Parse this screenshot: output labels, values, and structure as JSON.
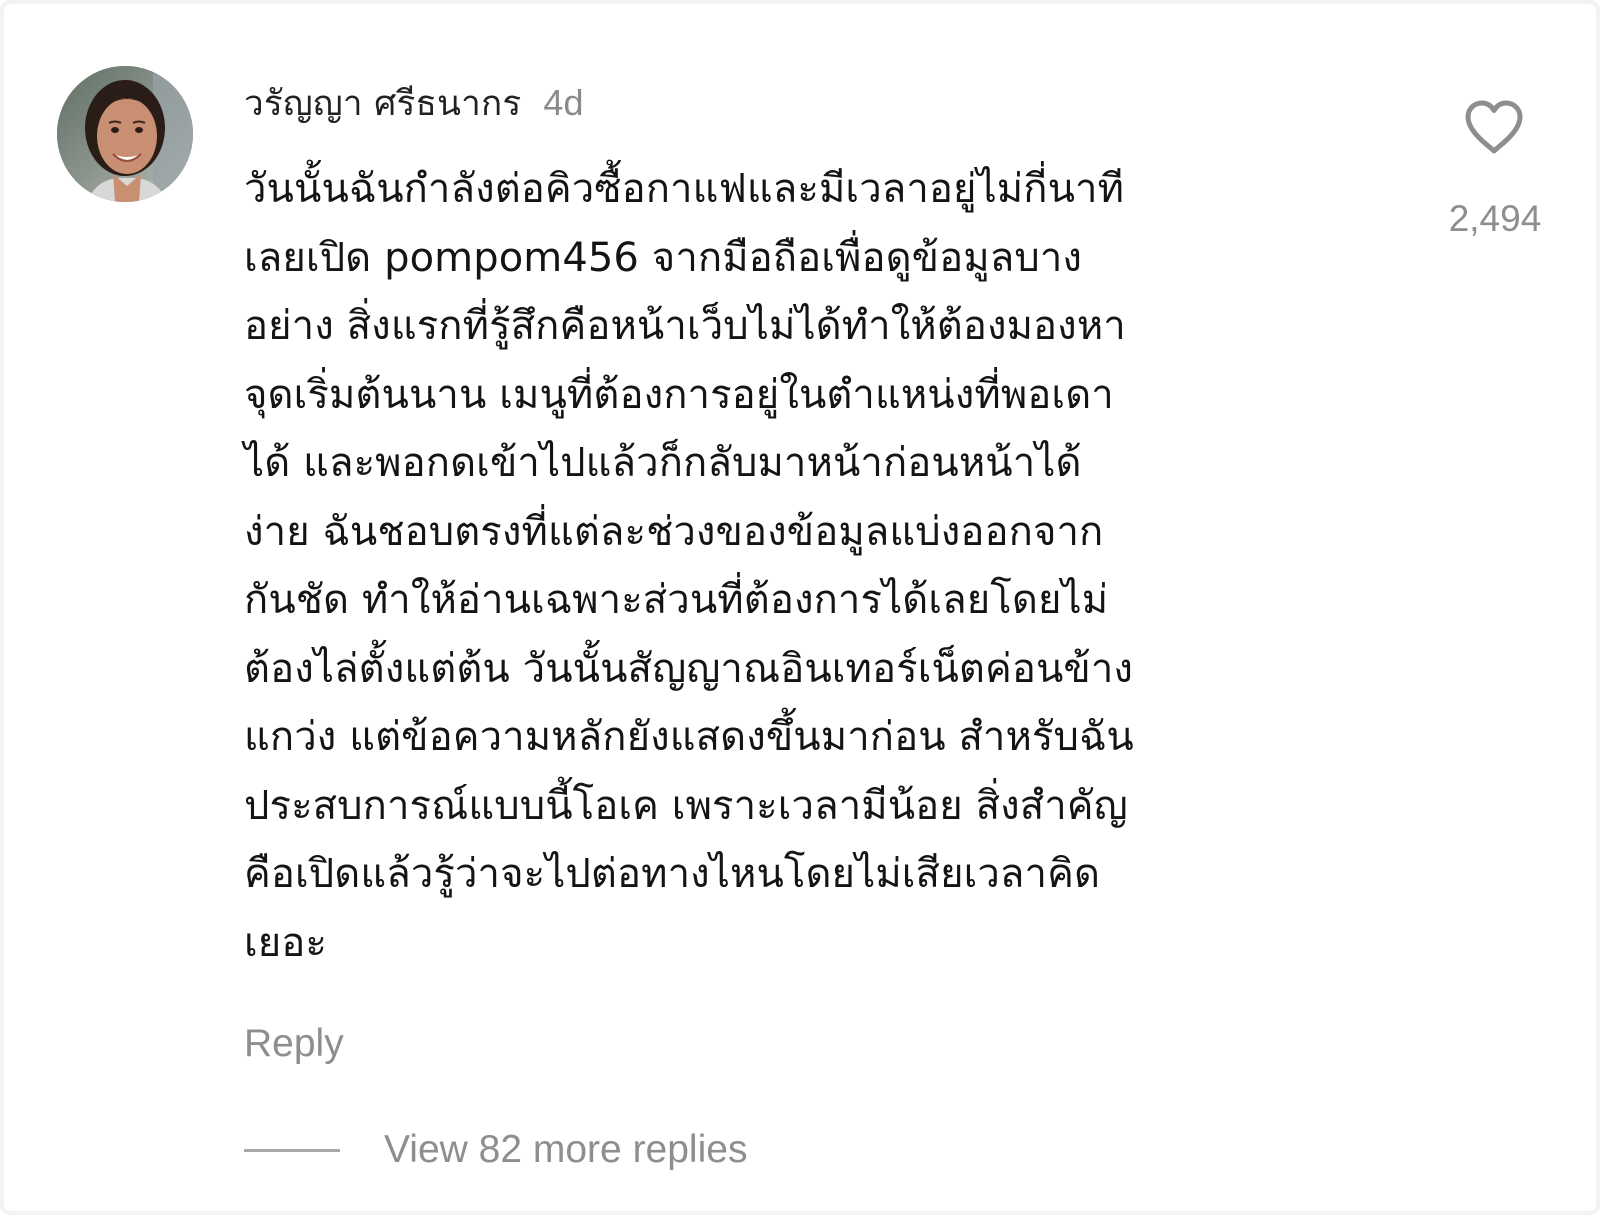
{
  "comment": {
    "username": "วรัญญา ศรีธนากร",
    "timestamp": "4d",
    "avatar_icon": "user-avatar-photo",
    "text": "วันนั้นฉันกำลังต่อคิวซื้อกาแฟและมีเวลาอยู่ไม่กี่นาที\nเลยเปิด pompom456 จากมือถือเพื่อดูข้อมูลบาง\nอย่าง สิ่งแรกที่รู้สึกคือหน้าเว็บไม่ได้ทำให้ต้องมองหา\nจุดเริ่มต้นนาน เมนูที่ต้องการอยู่ในตำแหน่งที่พอเดา\nได้ และพอกดเข้าไปแล้วก็กลับมาหน้าก่อนหน้าได้\nง่าย ฉันชอบตรงที่แต่ละช่วงของข้อมูลแบ่งออกจาก\nกันชัด ทำให้อ่านเฉพาะส่วนที่ต้องการได้เลยโดยไม่\nต้องไล่ตั้งแต่ต้น วันนั้นสัญญาณอินเทอร์เน็ตค่อนข้าง\nแกว่ง แต่ข้อความหลักยังแสดงขึ้นมาก่อน สำหรับฉัน\nประสบการณ์แบบนี้โอเค เพราะเวลามีน้อย สิ่งสำคัญ\nคือเปิดแล้วรู้ว่าจะไปต่อทางไหนโดยไม่เสียเวลาคิด\nเยอะ",
    "reply_label": "Reply",
    "view_replies_label": "View 82 more replies",
    "like_icon": "heart-outline-icon",
    "like_count": "2,494"
  },
  "colors": {
    "text_primary": "#141414",
    "text_secondary": "#8e8e8e",
    "background": "#ffffff"
  }
}
